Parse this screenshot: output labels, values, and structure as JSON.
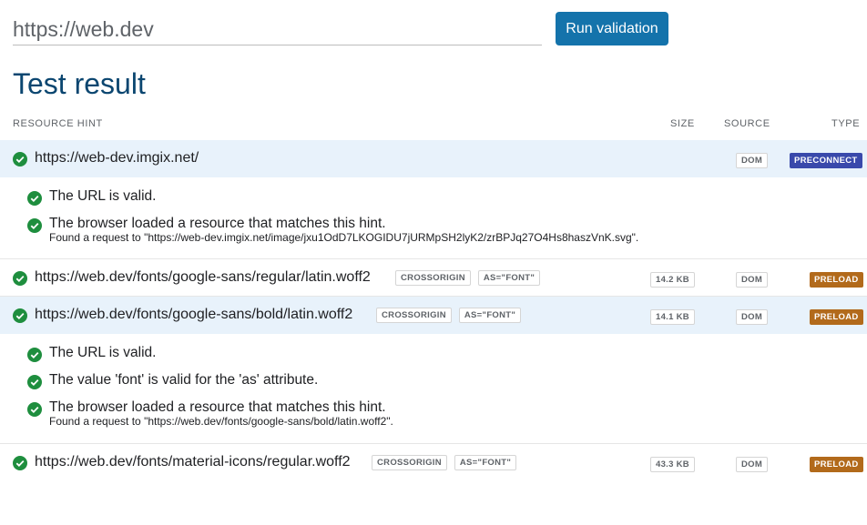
{
  "search": {
    "value": "https://web.dev"
  },
  "run_button": "Run validation",
  "title": "Test result",
  "headers": {
    "hint": "RESOURCE HINT",
    "size": "SIZE",
    "source": "SOURCE",
    "type": "TYPE"
  },
  "colors": {
    "accent": "#1473ab",
    "title": "#0b4670",
    "check": "#1e8e3e",
    "preconnect": "#3949ab",
    "preload": "#b26a1b",
    "highlight": "#e8f2fb"
  },
  "rows": [
    {
      "url": "https://web-dev.imgix.net/",
      "source": "DOM",
      "type": "PRECONNECT",
      "details": [
        "The URL is valid.",
        "The browser loaded a resource that matches this hint."
      ],
      "found": "Found a request to \"https://web-dev.imgix.net/image/jxu1OdD7LKOGIDU7jURMpSH2lyK2/zrBPJq27O4Hs8haszVnK.svg\"."
    },
    {
      "url": "https://web.dev/fonts/google-sans/regular/latin.woff2",
      "chips": [
        "CROSSORIGIN",
        "AS=\"FONT\""
      ],
      "size": "14.2 KB",
      "source": "DOM",
      "type": "PRELOAD"
    },
    {
      "url": "https://web.dev/fonts/google-sans/bold/latin.woff2",
      "chips": [
        "CROSSORIGIN",
        "AS=\"FONT\""
      ],
      "size": "14.1 KB",
      "source": "DOM",
      "type": "PRELOAD",
      "details": [
        "The URL is valid.",
        "The value 'font' is valid for the 'as' attribute.",
        "The browser loaded a resource that matches this hint."
      ],
      "found": "Found a request to \"https://web.dev/fonts/google-sans/bold/latin.woff2\"."
    },
    {
      "url": "https://web.dev/fonts/material-icons/regular.woff2",
      "chips": [
        "CROSSORIGIN",
        "AS=\"FONT\""
      ],
      "size": "43.3 KB",
      "source": "DOM",
      "type": "PRELOAD"
    }
  ]
}
